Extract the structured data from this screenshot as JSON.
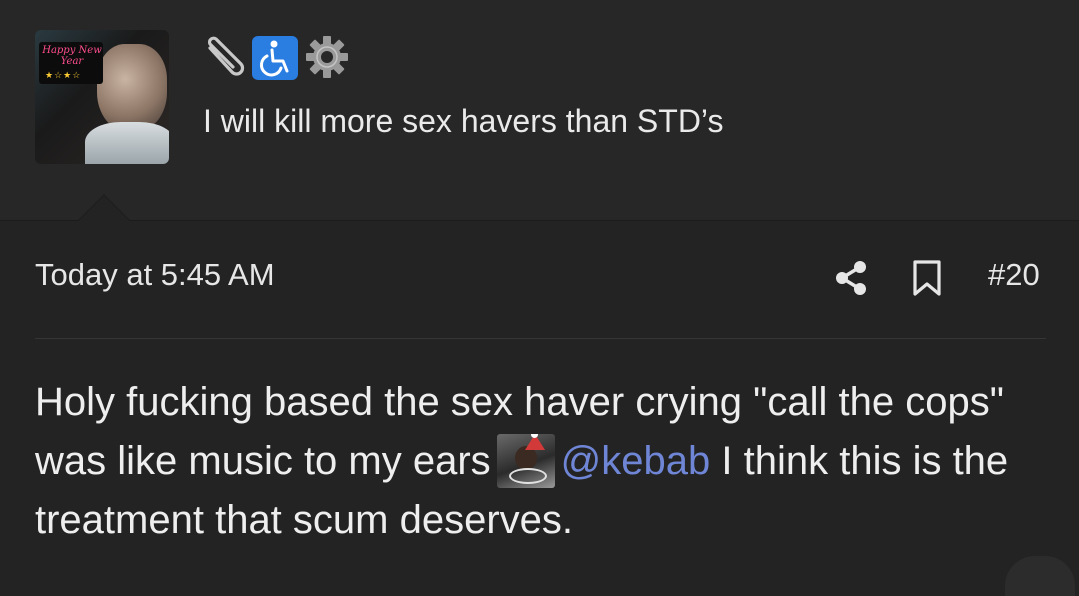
{
  "header": {
    "signature": "I will kill more sex havers than STD’s",
    "badges": [
      "paperclip-icon",
      "wheelchair-icon",
      "gear-icon"
    ],
    "avatar_text": "Happy New Year"
  },
  "post": {
    "timestamp": "Today at 5:45 AM",
    "post_number": "#20",
    "body_before_emoji": "Holy fucking based the sex haver crying \"call the cops\" was like music to my ears",
    "mention": "@kebab",
    "body_after_mention": " I think this is the treatment that scum deserves."
  },
  "colors": {
    "background": "#232323",
    "header_background": "#272727",
    "mention": "#6f86d6",
    "badge_blue": "#2a7de1"
  }
}
